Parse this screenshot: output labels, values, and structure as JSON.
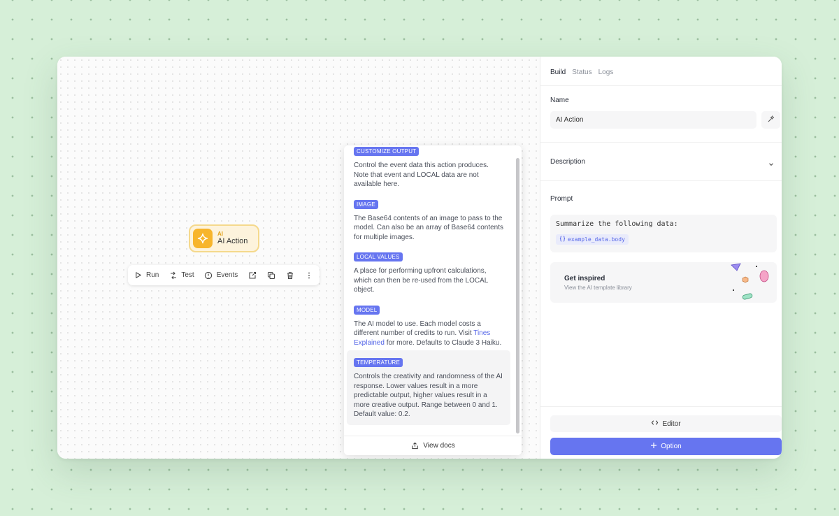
{
  "canvas": {
    "node": {
      "kind": "AI",
      "name": "AI Action"
    },
    "toolbar": {
      "run": "Run",
      "test": "Test",
      "events": "Events"
    }
  },
  "docs": {
    "items": [
      {
        "tag": "CUSTOMIZE OUTPUT",
        "desc": "Control the event data this action produces. Note that event and LOCAL data are not available here."
      },
      {
        "tag": "IMAGE",
        "desc": "The Base64 contents of an image to pass to the model. Can also be an array of Base64 contents for multiple images."
      },
      {
        "tag": "LOCAL VALUES",
        "desc": "A place for performing upfront calculations, which can then be re-used from the LOCAL object."
      },
      {
        "tag": "MODEL",
        "desc_before": "The AI model to use. Each model costs a different number of credits to run. Visit ",
        "link": "Tines Explained",
        "desc_after": " for more. Defaults to Claude 3 Haiku."
      },
      {
        "tag": "TEMPERATURE",
        "desc": "Controls the creativity and randomness of the AI response. Lower values result in a more predictable output, higher values result in a more creative output. Range between 0 and 1. Default value: 0.2."
      }
    ],
    "footer": "View docs"
  },
  "panel": {
    "tabs": [
      "Build",
      "Status",
      "Logs"
    ],
    "name_label": "Name",
    "name_value": "AI Action",
    "description_label": "Description",
    "prompt_label": "Prompt",
    "prompt_text": "Summarize the following data:",
    "prompt_var": "example_data.body",
    "inspire_title": "Get inspired",
    "inspire_sub": "View the AI template library",
    "editor_label": "Editor",
    "option_label": "Option"
  },
  "colors": {
    "accent": "#6675f0",
    "node": "#f7b52c",
    "background": "#d6efd8"
  }
}
